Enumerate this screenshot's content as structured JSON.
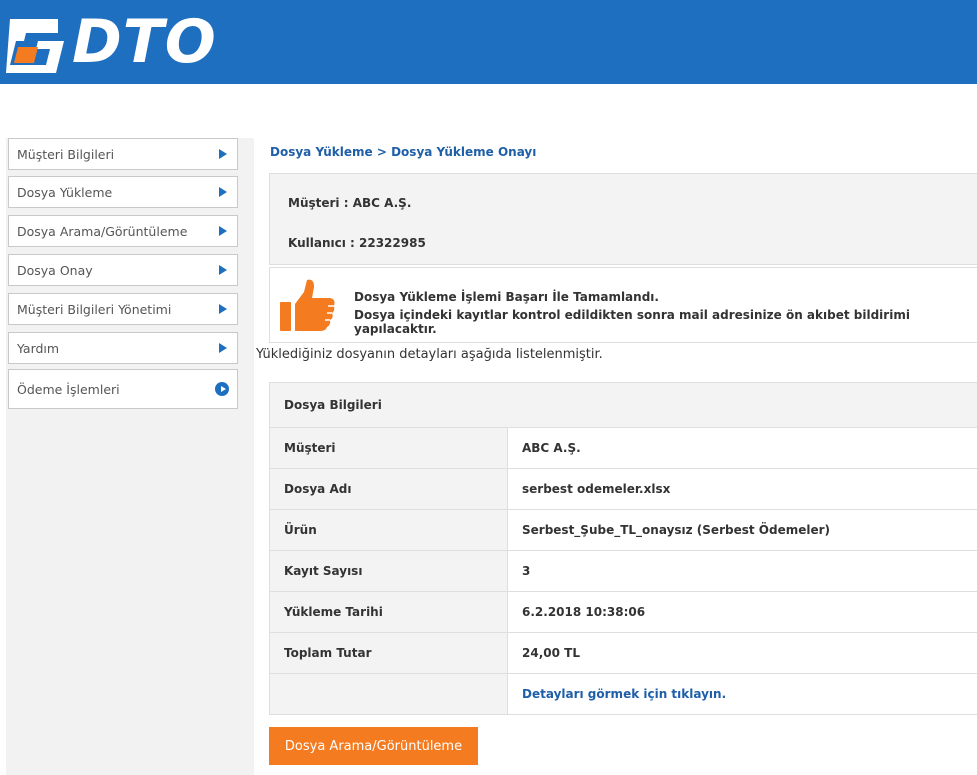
{
  "brand": {
    "name": "DTO",
    "primary": "#1f6fc1",
    "accent": "#f47b20"
  },
  "sidebar": {
    "items": [
      {
        "label": "Müşteri Bilgileri",
        "icon": "triangle-arrow-icon"
      },
      {
        "label": "Dosya Yükleme",
        "icon": "triangle-arrow-icon"
      },
      {
        "label": "Dosya Arama/Görüntüleme",
        "icon": "triangle-arrow-icon"
      },
      {
        "label": "Dosya Onay",
        "icon": "triangle-arrow-icon"
      },
      {
        "label": "Müşteri Bilgileri Yönetimi",
        "icon": "triangle-arrow-icon"
      },
      {
        "label": "Yardım",
        "icon": "triangle-arrow-icon"
      },
      {
        "label": "Ödeme İşlemleri",
        "icon": "circle-arrow-icon"
      }
    ]
  },
  "breadcrumb": "Dosya Yükleme > Dosya Yükleme Onayı",
  "customer_info": {
    "customer": "Müşteri :  ABC A.Ş.",
    "user": "Kullanıcı : 22322985"
  },
  "success": {
    "icon": "thumbs-up-icon",
    "line1": "Dosya Yükleme İşlemi Başarı İle Tamamlandı.",
    "line2": "Dosya içindeki kayıtlar kontrol edildikten sonra mail adresinize ön akıbet bildirimi yapılacaktır."
  },
  "intro_text": "Yüklediğiniz dosyanın detayları aşağıda listelenmiştir.",
  "file_table": {
    "title": "Dosya Bilgileri",
    "rows": [
      {
        "label": "Müşteri",
        "value": "ABC A.Ş."
      },
      {
        "label": "Dosya Adı",
        "value": "serbest odemeler.xlsx"
      },
      {
        "label": "Ürün",
        "value": "Serbest_Şube_TL_onaysız (Serbest Ödemeler)"
      },
      {
        "label": "Kayıt Sayısı",
        "value": "3"
      },
      {
        "label": "Yükleme Tarihi",
        "value": "6.2.2018 10:38:06"
      },
      {
        "label": "Toplam Tutar",
        "value": "24,00 TL"
      },
      {
        "label": "",
        "value": "Detayları görmek için tıklayın."
      }
    ]
  },
  "search_button_label": "Dosya Arama/Görüntüleme"
}
